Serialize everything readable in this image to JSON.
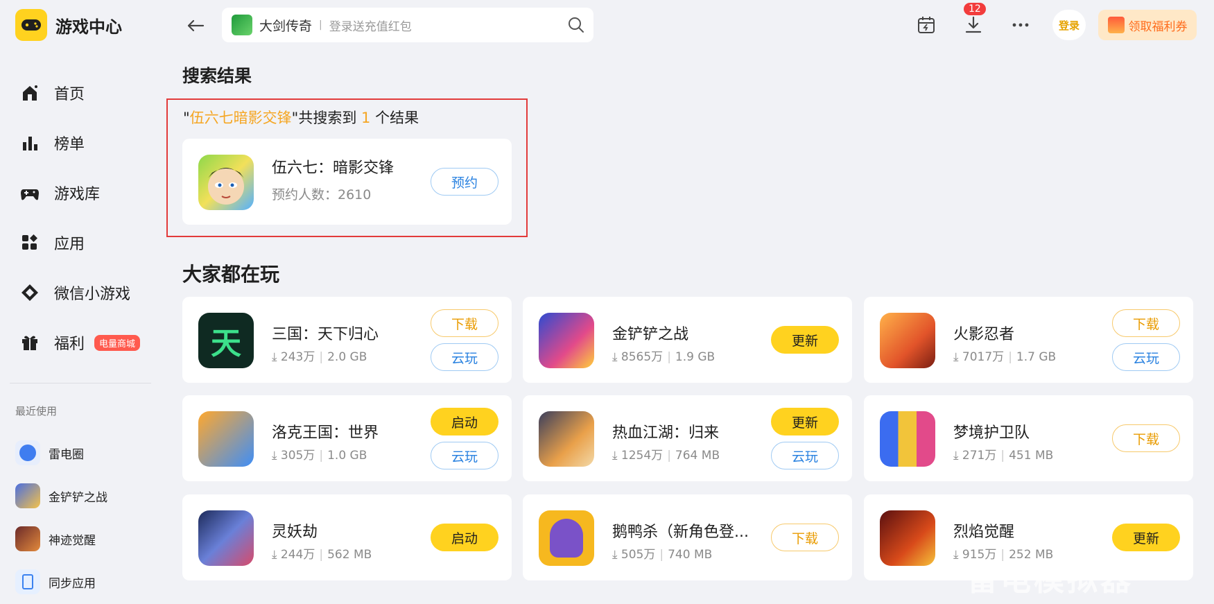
{
  "app": {
    "title": "游戏中心"
  },
  "sidebar": {
    "items": [
      {
        "label": "首页"
      },
      {
        "label": "榜单"
      },
      {
        "label": "游戏库"
      },
      {
        "label": "应用"
      },
      {
        "label": "微信小游戏"
      },
      {
        "label": "福利",
        "badge": "电量商城"
      }
    ],
    "recent_title": "最近使用",
    "recent": [
      {
        "label": "雷电圈"
      },
      {
        "label": "金铲铲之战"
      },
      {
        "label": "神迹觉醒"
      },
      {
        "label": "同步应用"
      }
    ]
  },
  "topbar": {
    "search_query": "大剑传奇",
    "search_separator": "|",
    "search_placeholder": "登录送充值红包",
    "download_badge": "12",
    "login_label": "登录",
    "coupon_label": "领取福利券"
  },
  "search_section": {
    "title": "搜索结果",
    "summary_prefix": "\"",
    "summary_query": "伍六七暗影交锋",
    "summary_mid": "\"共搜索到 ",
    "summary_count": "1",
    "summary_suffix": " 个结果",
    "result": {
      "name": "伍六七：暗影交锋",
      "meta": "预约人数：2610",
      "button": "预约"
    }
  },
  "popular": {
    "title": "大家都在玩",
    "games": [
      {
        "name": "三国：天下归心",
        "downloads": "243万",
        "size": "2.0 GB",
        "buttons": [
          "下载",
          "云玩"
        ]
      },
      {
        "name": "金铲铲之战",
        "downloads": "8565万",
        "size": "1.9 GB",
        "buttons": [
          "更新"
        ]
      },
      {
        "name": "火影忍者",
        "downloads": "7017万",
        "size": "1.7 GB",
        "buttons": [
          "下载",
          "云玩"
        ]
      },
      {
        "name": "洛克王国：世界",
        "downloads": "305万",
        "size": "1.0 GB",
        "buttons": [
          "启动",
          "云玩"
        ]
      },
      {
        "name": "热血江湖：归来",
        "downloads": "1254万",
        "size": "764 MB",
        "buttons": [
          "更新",
          "云玩"
        ]
      },
      {
        "name": "梦境护卫队",
        "downloads": "271万",
        "size": "451 MB",
        "buttons": [
          "下载"
        ]
      },
      {
        "name": "灵妖劫",
        "downloads": "244万",
        "size": "562 MB",
        "buttons": [
          "启动"
        ]
      },
      {
        "name": "鹅鸭杀（新角色登...",
        "downloads": "505万",
        "size": "740 MB",
        "buttons": [
          "下载"
        ]
      },
      {
        "name": "烈焰觉醒",
        "downloads": "915万",
        "size": "252 MB",
        "buttons": [
          "更新"
        ]
      }
    ]
  },
  "watermark": "雷电模拟器",
  "colors": {
    "accent_yellow": "#ffd21f",
    "outline_yellow": "#f7c96b",
    "outline_blue": "#9fcaf3",
    "highlight": "#f5a623",
    "red_box": "#e23a3a"
  },
  "icons": [
    "home-icon",
    "rank-icon",
    "gamepad-icon",
    "apps-icon",
    "wechat-game-icon",
    "gift-icon",
    "calendar-icon",
    "download-icon",
    "more-icon",
    "search-icon",
    "back-arrow-icon"
  ]
}
